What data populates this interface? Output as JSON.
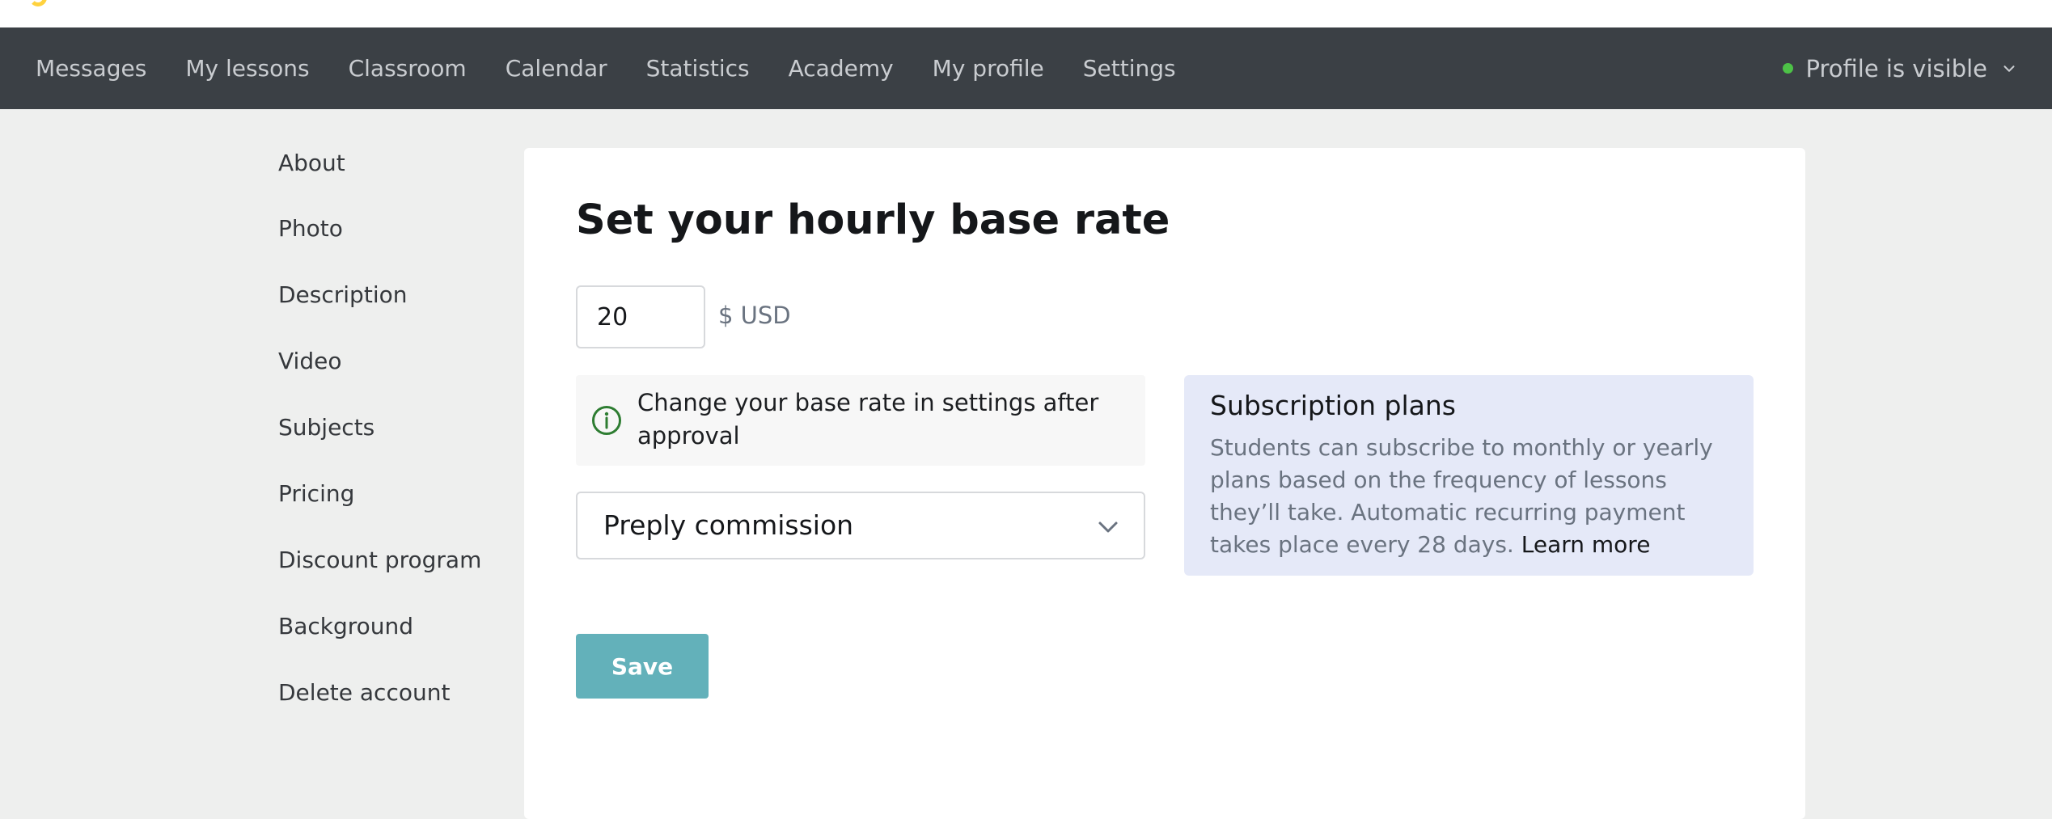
{
  "nav": {
    "items": [
      {
        "label": "Messages"
      },
      {
        "label": "My lessons"
      },
      {
        "label": "Classroom"
      },
      {
        "label": "Calendar"
      },
      {
        "label": "Statistics"
      },
      {
        "label": "Academy"
      },
      {
        "label": "My profile"
      },
      {
        "label": "Settings"
      }
    ],
    "visibility_label": "Profile is visible"
  },
  "sidebar": {
    "items": [
      {
        "label": "About"
      },
      {
        "label": "Photo"
      },
      {
        "label": "Description"
      },
      {
        "label": "Video"
      },
      {
        "label": "Subjects"
      },
      {
        "label": "Pricing"
      },
      {
        "label": "Discount program"
      },
      {
        "label": "Background"
      },
      {
        "label": "Delete account"
      }
    ]
  },
  "main": {
    "title": "Set your hourly base rate",
    "rate_value": "20",
    "currency": "$ USD",
    "notice": "Change your base rate in settings after approval",
    "commission_label": "Preply commission",
    "plans": {
      "title": "Subscription plans",
      "body": "Students can subscribe to monthly or yearly plans based on the frequency of lessons they’ll take. Automatic recurring payment takes place every 28 days.",
      "link": "Learn more"
    },
    "save_label": "Save"
  },
  "colors": {
    "navbar": "#3b4045",
    "accent_button": "#63b1ba",
    "status_visible": "#4dc247",
    "plans_bg": "#e5e9f8"
  }
}
